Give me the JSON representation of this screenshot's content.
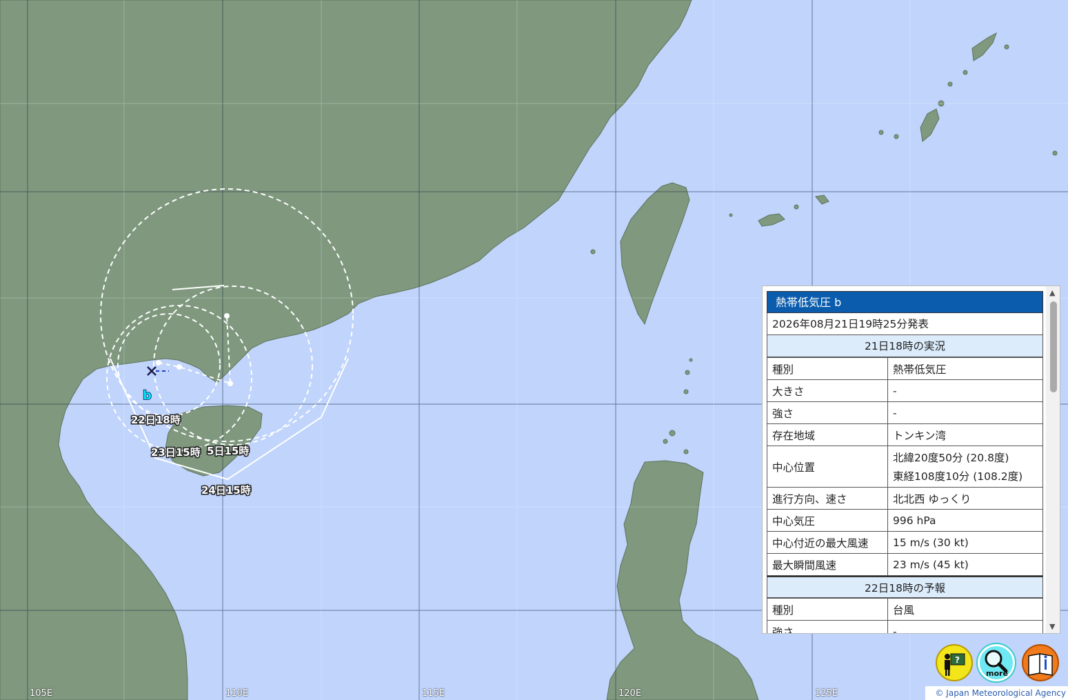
{
  "colors": {
    "sea": "#c0d4fc",
    "land": "#7f987e",
    "header": "#0b5cad",
    "section": "#dcecfb"
  },
  "axis_labels": [
    "105E",
    "110E",
    "115E",
    "120E",
    "125E"
  ],
  "storm": {
    "letter": "b",
    "track_labels": [
      "22日18時",
      "23日15時",
      "5日15時",
      "24日15時"
    ]
  },
  "panel": {
    "title": "熱帯低気圧 b",
    "issued": "2026年08月21日19時25分発表",
    "section1": "21日18時の実況",
    "rows1": [
      {
        "k": "種別",
        "v": "熱帯低気圧"
      },
      {
        "k": "大きさ",
        "v": "-"
      },
      {
        "k": "強さ",
        "v": "-"
      },
      {
        "k": "存在地域",
        "v": "トンキン湾"
      },
      {
        "k": "中心位置",
        "v": "北緯20度50分 (20.8度)",
        "v2": "東経108度10分 (108.2度)"
      },
      {
        "k": "進行方向、速さ",
        "v": "北北西 ゆっくり"
      },
      {
        "k": "中心気圧",
        "v": "996 hPa"
      },
      {
        "k": "中心付近の最大風速",
        "v": "15 m/s (30 kt)"
      },
      {
        "k": "最大瞬間風速",
        "v": "23 m/s (45 kt)"
      }
    ],
    "section2": "22日18時の予報",
    "rows2": [
      {
        "k": "種別",
        "v": "台風"
      },
      {
        "k": "強さ",
        "v": "-"
      }
    ]
  },
  "buttons": {
    "more_label": "more"
  },
  "copyright": "© Japan Meteorological Agency"
}
